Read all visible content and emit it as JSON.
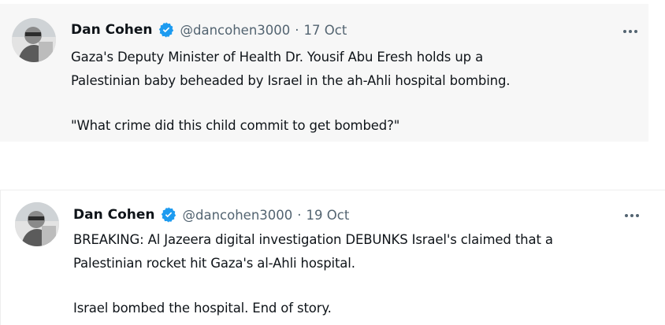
{
  "tweets": [
    {
      "author_name": "Dan Cohen",
      "handle": "@dancohen3000",
      "separator": "·",
      "date": "17 Oct",
      "lines": [
        "Gaza's Deputy Minister of Health Dr. Yousif Abu Eresh holds up a",
        "Palestinian baby beheaded by Israel in the ah-Ahli hospital bombing."
      ],
      "quote": "\"What crime did this child commit to get bombed?\""
    },
    {
      "author_name": "Dan Cohen",
      "handle": "@dancohen3000",
      "separator": "·",
      "date": "19 Oct",
      "lines": [
        "BREAKING: Al Jazeera digital investigation DEBUNKS Israel's claimed that a",
        "Palestinian rocket hit Gaza's al-Ahli hospital."
      ],
      "quote": "Israel bombed the hospital. End of story."
    }
  ],
  "icons": {
    "verified": "verified-badge-icon",
    "more": "more-options-icon"
  },
  "colors": {
    "verified_blue": "#1d9bf0",
    "secondary_text": "#536471",
    "primary_text": "#0f1419",
    "tweet1_background": "#f7f7f7"
  }
}
